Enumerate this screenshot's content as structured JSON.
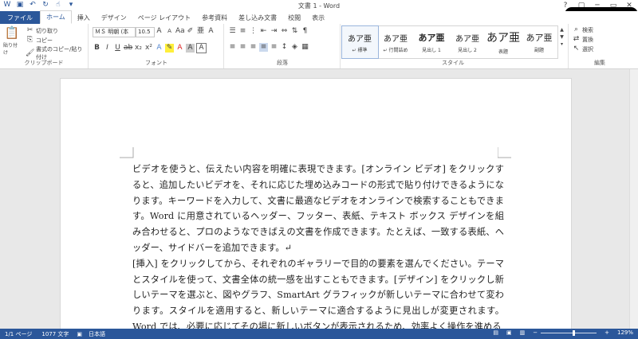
{
  "window": {
    "title": "文書 1 - Word",
    "controls": [
      "?",
      "▢",
      "─",
      "▭",
      "✕"
    ]
  },
  "tabs": [
    "ファイル",
    "ホーム",
    "挿入",
    "デザイン",
    "ページ レイアウト",
    "参考資料",
    "差し込み文書",
    "校閲",
    "表示"
  ],
  "active_tab": "ホーム",
  "ribbon": {
    "clipboard": {
      "paste_label": "貼り付け",
      "cut_label": "切り取り",
      "copy_label": "コピー",
      "format_painter_label": "書式のコピー/貼り付け",
      "group_label": "クリップボード"
    },
    "font": {
      "font_name": "ＭＳ 明朝 (本",
      "font_size": "10.5",
      "group_label": "フォント"
    },
    "paragraph": {
      "group_label": "段落"
    },
    "styles": {
      "group_label": "スタイル",
      "items": [
        {
          "preview": "あア亜",
          "name": "↵ 標準"
        },
        {
          "preview": "あア亜",
          "name": "↵ 行間詰め"
        },
        {
          "preview": "あア亜",
          "name": "見出し 1"
        },
        {
          "preview": "あア亜",
          "name": "見出し 2"
        },
        {
          "preview": "あア亜",
          "name": "表題"
        },
        {
          "preview": "あア亜",
          "name": "副題"
        }
      ]
    },
    "editing": {
      "group_label": "編集",
      "find_label": "検索",
      "replace_label": "置換",
      "select_label": "選択"
    }
  },
  "document": {
    "paragraph1": "ビデオを使うと、伝えたい内容を明確に表現できます。[オンライン ビデオ] をクリックすると、追加したいビデオを、それに応じた埋め込みコードの形式で貼り付けできるようになります。キーワードを入力して、文書に最適なビデオをオンラインで検索することもできます。Word に用意されているヘッダー、フッター、表紙、テキスト ボックス デザインを組み合わせると、プロのようなできばえの文書を作成できます。たとえば、一致する表紙、ヘッダー、サイドバーを追加できます。↵",
    "paragraph2": "[挿入] をクリックしてから、それぞれのギャラリーで目的の要素を選んでください。テーマとスタイルを使って、文書全体の統一感を出すこともできます。[デザイン] をクリックし新しいテーマを選ぶと、図やグラフ、SmartArt グラフィックが新しいテーマに合わせて変わります。スタイルを適用すると、新しいテーマに適合するように見出しが変更されます。Word では、必要に応じてその場に新しいボタンが表示されるため、効率よく操作を進める"
  },
  "status": {
    "page": "1/1 ページ",
    "words": "1077 文字",
    "language": "日本語",
    "zoom": "129%"
  },
  "colors": {
    "accent": "#2b579a",
    "ribbon_bg": "#ffffff",
    "canvas_bg": "#e8e8e8"
  }
}
